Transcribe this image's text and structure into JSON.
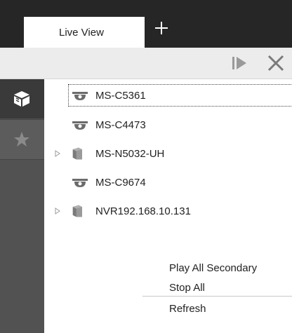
{
  "tabs": {
    "active_label": "Live View",
    "add_icon": "plus-icon"
  },
  "toolbar": {
    "icons": [
      "play-next-icon",
      "close-icon"
    ]
  },
  "sidebar": {
    "items": [
      {
        "icon": "device-cube-icon",
        "active": true
      },
      {
        "icon": "star-icon",
        "active": false
      }
    ]
  },
  "device_tree": {
    "items": [
      {
        "label": "MS-C5361",
        "type": "dome-camera",
        "expandable": false,
        "selected": true
      },
      {
        "label": "MS-C4473",
        "type": "dome-camera",
        "expandable": false,
        "selected": false
      },
      {
        "label": "MS-N5032-UH",
        "type": "nvr",
        "expandable": true,
        "selected": false
      },
      {
        "label": "MS-C9674",
        "type": "dome-camera",
        "expandable": false,
        "selected": false
      },
      {
        "label": "NVR192.168.10.131",
        "type": "nvr",
        "expandable": true,
        "selected": false
      }
    ]
  },
  "context_menu": {
    "items": [
      "Play All Secondary",
      "Stop All",
      "Refresh"
    ]
  },
  "colors": {
    "tab_bar": "#262626",
    "toolbar": "#ececec",
    "sidebar": "#525252",
    "sidebar_active": "#3a3a3a",
    "camera_icon": "#6b6b6b",
    "nvr_icon": "#7a7a7a"
  }
}
